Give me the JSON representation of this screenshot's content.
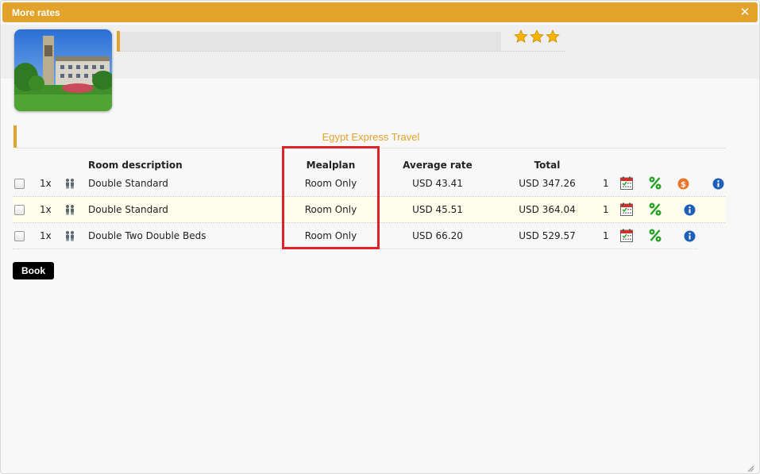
{
  "dialog": {
    "title": "More rates",
    "close_icon": "close-icon"
  },
  "hotel": {
    "photo_icon": "hotel-photo",
    "stars": 3,
    "star_color": "#f5b400"
  },
  "agency": {
    "name": "Egypt Express Travel"
  },
  "table": {
    "headers": {
      "room_description": "Room description",
      "mealplan": "Mealplan",
      "average_rate": "Average rate",
      "total": "Total"
    },
    "rows": [
      {
        "qty": "1x",
        "room": "Double Standard",
        "mealplan": "Room Only",
        "average_rate": "USD 43.41",
        "total": "USD 347.26",
        "count": "1",
        "icons": [
          "calendar-icon",
          "discount-icon",
          "dollar-icon",
          "info-icon"
        ]
      },
      {
        "qty": "1x",
        "room": "Double Standard",
        "mealplan": "Room Only",
        "average_rate": "USD 45.51",
        "total": "USD 364.04",
        "count": "1",
        "icons": [
          "calendar-icon",
          "discount-icon",
          "info-icon"
        ]
      },
      {
        "qty": "1x",
        "room": "Double Two Double Beds",
        "mealplan": "Room Only",
        "average_rate": "USD 66.20",
        "total": "USD 529.57",
        "count": "1",
        "icons": [
          "calendar-icon",
          "discount-icon",
          "info-icon"
        ]
      }
    ]
  },
  "actions": {
    "book_label": "Book"
  },
  "colors": {
    "accent": "#e3a22a",
    "highlight": "#e0202a",
    "discount": "#2aa12a",
    "info": "#1f5fb8",
    "dollar": "#e8772a"
  }
}
